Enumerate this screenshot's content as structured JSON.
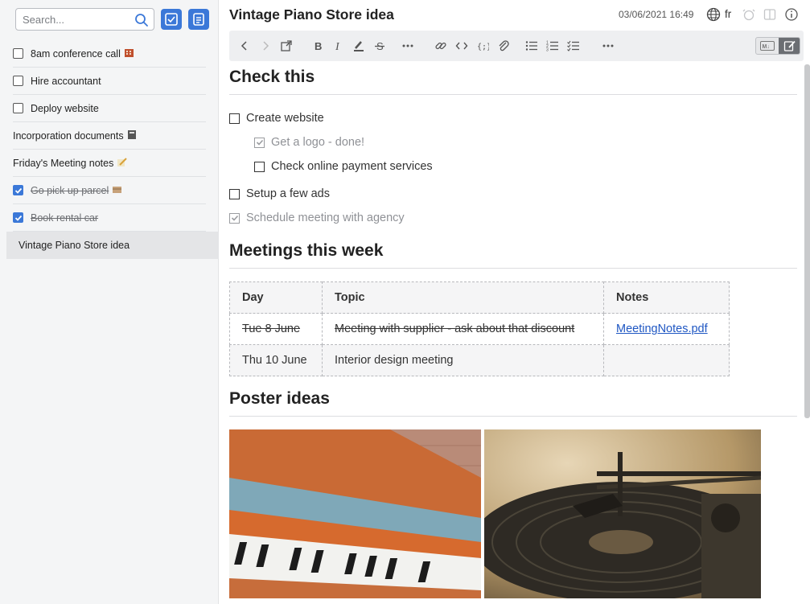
{
  "sidebar": {
    "search": {
      "placeholder": "Search..."
    },
    "items": [
      {
        "label": "8am conference call",
        "type": "todo",
        "checked": false,
        "emoji": "building-icon"
      },
      {
        "label": "Hire accountant",
        "type": "todo",
        "checked": false
      },
      {
        "label": "Deploy website",
        "type": "todo",
        "checked": false
      },
      {
        "label": "Incorporation documents",
        "type": "note",
        "emoji": "book-icon"
      },
      {
        "label": "Friday's Meeting notes",
        "type": "note",
        "emoji": "pencil-memo-icon"
      },
      {
        "label": "Go pick up parcel",
        "type": "todo",
        "checked": true,
        "emoji": "package-icon"
      },
      {
        "label": "Book rental car",
        "type": "todo",
        "checked": true
      },
      {
        "label": "Vintage Piano Store idea",
        "type": "note",
        "selected": true
      }
    ]
  },
  "header": {
    "title": "Vintage Piano Store idea",
    "timestamp": "03/06/2021 16:49",
    "language": "fr"
  },
  "content": {
    "section1": {
      "heading": "Check this",
      "items": [
        {
          "text": "Create website",
          "checked": false,
          "indent": 0
        },
        {
          "text": "Get a logo - done!",
          "checked": true,
          "indent": 1
        },
        {
          "text": "Check online payment services",
          "checked": false,
          "indent": 1
        },
        {
          "text": "Setup a few ads",
          "checked": false,
          "indent": 0
        },
        {
          "text": "Schedule meeting with agency",
          "checked": true,
          "indent": 0
        }
      ]
    },
    "section2": {
      "heading": "Meetings this week",
      "table": {
        "headers": [
          "Day",
          "Topic",
          "Notes"
        ],
        "rows": [
          {
            "day": "Tue 8 June",
            "topic": "Meeting with supplier - ask about that discount",
            "notes": "MeetingNotes.pdf",
            "struck": true
          },
          {
            "day": "Thu 10 June",
            "topic": "Interior design meeting",
            "notes": "",
            "struck": false
          }
        ]
      }
    },
    "section3": {
      "heading": "Poster ideas"
    }
  },
  "colors": {
    "accent": "#3b78d8",
    "sidebar_bg": "#f4f5f6",
    "toolbar_bg": "#eeeff1",
    "link": "#1f57c3"
  }
}
